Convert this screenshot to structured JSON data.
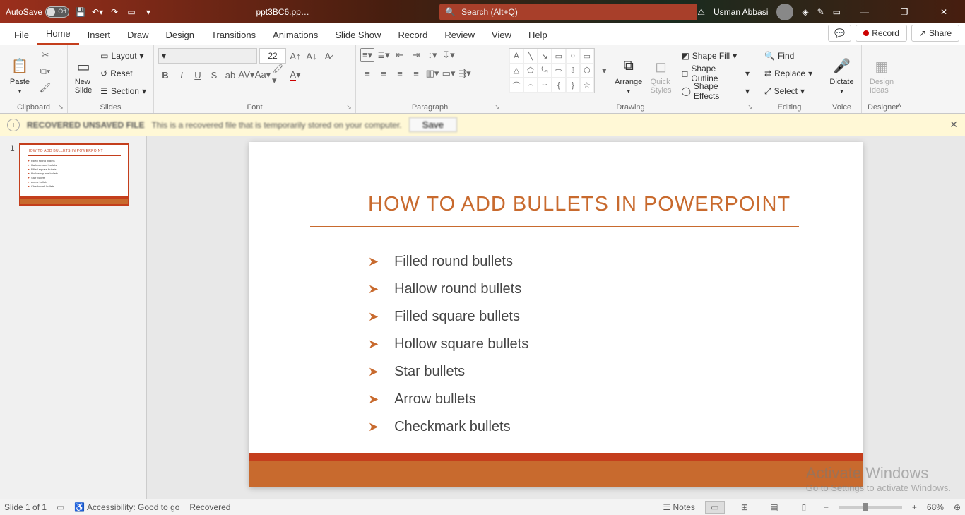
{
  "titlebar": {
    "autosave_label": "AutoSave",
    "autosave_state": "Off",
    "filename": "ppt3BC6.pp…",
    "search_placeholder": "Search (Alt+Q)",
    "username": "Usman Abbasi"
  },
  "tabs": {
    "file": "File",
    "home": "Home",
    "insert": "Insert",
    "draw": "Draw",
    "design": "Design",
    "transitions": "Transitions",
    "animations": "Animations",
    "slideshow": "Slide Show",
    "record": "Record",
    "review": "Review",
    "view": "View",
    "help": "Help",
    "record_btn": "Record",
    "share_btn": "Share"
  },
  "ribbon": {
    "clipboard": {
      "label": "Clipboard",
      "paste": "Paste"
    },
    "slides": {
      "label": "Slides",
      "new_slide": "New\nSlide",
      "layout": "Layout",
      "reset": "Reset",
      "section": "Section"
    },
    "font": {
      "label": "Font",
      "size": "22"
    },
    "paragraph": {
      "label": "Paragraph"
    },
    "drawing": {
      "label": "Drawing",
      "arrange": "Arrange",
      "quick_styles": "Quick\nStyles",
      "shape_fill": "Shape Fill",
      "shape_outline": "Shape Outline",
      "shape_effects": "Shape Effects"
    },
    "editing": {
      "label": "Editing",
      "find": "Find",
      "replace": "Replace",
      "select": "Select"
    },
    "voice": {
      "label": "Voice",
      "dictate": "Dictate"
    },
    "designer": {
      "label": "Designer",
      "design_ideas": "Design\nIdeas"
    }
  },
  "recovered": {
    "title": "RECOVERED UNSAVED FILE",
    "text": "This is a recovered file that is temporarily stored on your computer.",
    "save": "Save"
  },
  "slide": {
    "title": "HOW TO ADD BULLETS IN POWERPOINT",
    "bullets": [
      "Filled round bullets",
      "Hallow round bullets",
      "Filled square bullets",
      "Hollow square bullets",
      "Star bullets",
      "Arrow bullets",
      "Checkmark bullets"
    ]
  },
  "thumb": {
    "number": "1"
  },
  "activate": {
    "line1": "Activate Windows",
    "line2": "Go to Settings to activate Windows."
  },
  "status": {
    "slide_count": "Slide 1 of 1",
    "accessibility": "Accessibility: Good to go",
    "recovered": "Recovered",
    "notes": "Notes",
    "zoom": "68%"
  }
}
